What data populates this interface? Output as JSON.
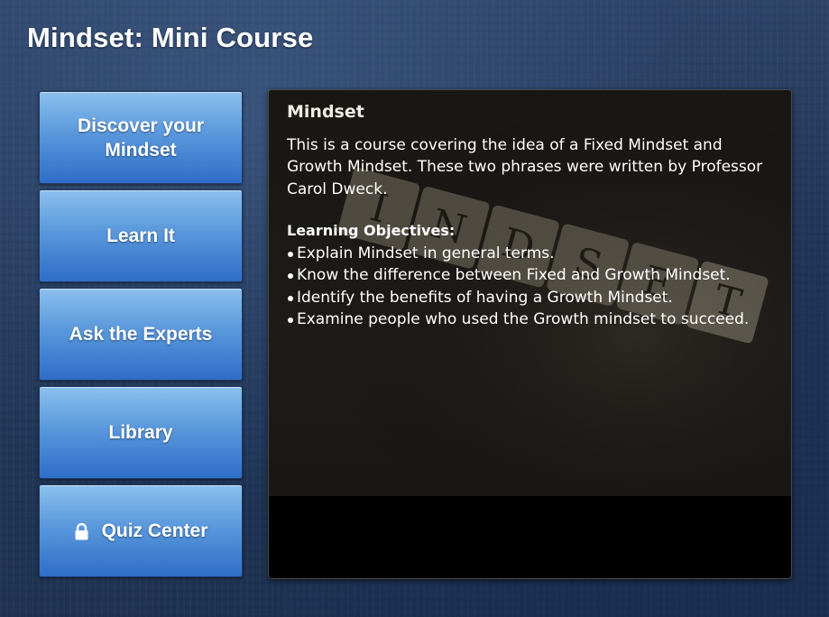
{
  "app": {
    "title": "Mindset: Mini Course"
  },
  "nav": {
    "items": [
      {
        "label": "Discover your Mindset",
        "icon": null
      },
      {
        "label": "Learn It",
        "icon": null
      },
      {
        "label": "Ask the Experts",
        "icon": null
      },
      {
        "label": "Library",
        "icon": null
      },
      {
        "label": "Quiz Center",
        "icon": "lock-icon"
      }
    ]
  },
  "content": {
    "heading": "Mindset",
    "intro": "This is a course covering the idea of a Fixed Mindset and Growth Mindset.  These two phrases were written by Professor Carol Dweck.",
    "objectives_heading": "Learning Objectives:",
    "objectives": [
      "Explain Mindset in general terms.",
      "Know the difference between Fixed and Growth Mindset.",
      "Identify the benefits of having a Growth Mindset.",
      "Examine people who used the Growth mindset to succeed."
    ],
    "image_tiles": [
      "I",
      "N",
      "D",
      "S",
      "E",
      "T"
    ]
  },
  "colors": {
    "button_top": "#8cc0ec",
    "button_bottom": "#2f6ec8",
    "background": "#23395a",
    "panel": "#000000"
  }
}
